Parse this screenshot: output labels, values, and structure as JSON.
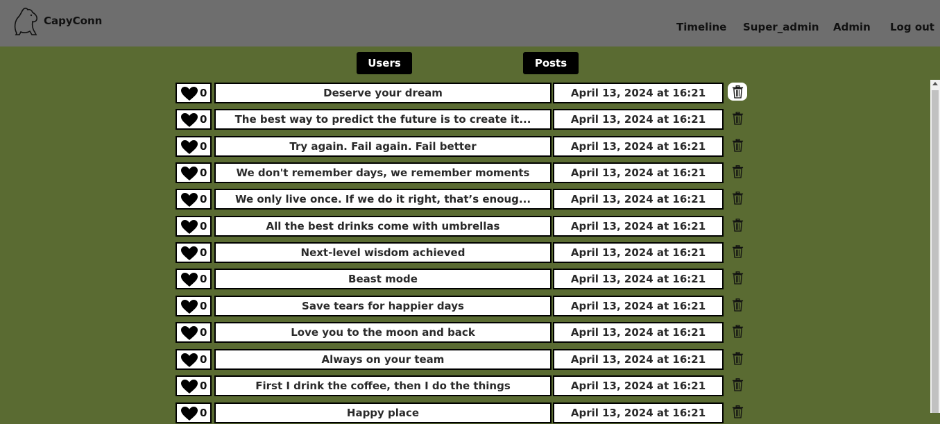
{
  "brand": {
    "name": "CapyConn",
    "logo_icon": "capybara-icon"
  },
  "nav": [
    "Timeline",
    "Super_admin",
    "Admin",
    "Log out"
  ],
  "tabs": {
    "users": "Users",
    "posts": "Posts"
  },
  "colors": {
    "background": "#5a6b32",
    "topbar": "#6e6e6e",
    "tab_button": "#000000"
  },
  "posts": [
    {
      "likes": "0",
      "title": "Deserve your dream",
      "date": "April 13, 2024 at 16:21"
    },
    {
      "likes": "0",
      "title": "The best way to predict the future is to create it...",
      "date": "April 13, 2024 at 16:21"
    },
    {
      "likes": "0",
      "title": "Try again. Fail again. Fail better",
      "date": "April 13, 2024 at 16:21"
    },
    {
      "likes": "0",
      "title": "We don't remember days, we remember moments",
      "date": "April 13, 2024 at 16:21"
    },
    {
      "likes": "0",
      "title": "We only live once. If we do it right, that’s enoug...",
      "date": "April 13, 2024 at 16:21"
    },
    {
      "likes": "0",
      "title": "All the best drinks come with umbrellas",
      "date": "April 13, 2024 at 16:21"
    },
    {
      "likes": "0",
      "title": "Next-level wisdom achieved",
      "date": "April 13, 2024 at 16:21"
    },
    {
      "likes": "0",
      "title": "Beast mode",
      "date": "April 13, 2024 at 16:21"
    },
    {
      "likes": "0",
      "title": "Save tears for happier days",
      "date": "April 13, 2024 at 16:21"
    },
    {
      "likes": "0",
      "title": "Love you to the moon and back",
      "date": "April 13, 2024 at 16:21"
    },
    {
      "likes": "0",
      "title": "Always on your team",
      "date": "April 13, 2024 at 16:21"
    },
    {
      "likes": "0",
      "title": "First I drink the coffee, then I do the things",
      "date": "April 13, 2024 at 16:21"
    },
    {
      "likes": "0",
      "title": "Happy place",
      "date": "April 13, 2024 at 16:21"
    }
  ]
}
